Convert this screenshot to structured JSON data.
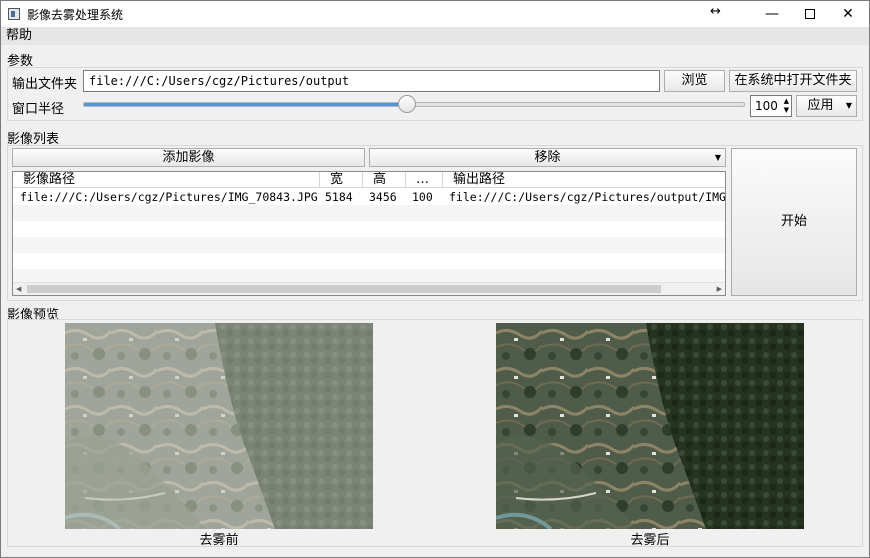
{
  "window": {
    "title": "影像去雾处理系统",
    "resize_glyph": "↔",
    "min_glyph": "—",
    "close_glyph": "✕"
  },
  "menu": {
    "help": "帮助"
  },
  "params": {
    "section_title": "参数",
    "output_folder_label": "输出文件夹",
    "output_folder_value": "file:///C:/Users/cgz/Pictures/output",
    "browse_label": "浏览",
    "open_folder_label": "在系统中打开文件夹",
    "window_radius_label": "窗口半径",
    "window_radius_value": "100",
    "slider_fraction": 0.49,
    "apply_label": "应用"
  },
  "image_list": {
    "section_title": "影像列表",
    "add_label": "添加影像",
    "remove_label": "移除",
    "columns": [
      "影像路径",
      "宽",
      "高",
      "…",
      "输出路径"
    ],
    "rows": [
      {
        "path": "file:///C:/Users/cgz/Pictures/IMG_70843.JPG",
        "width": "5184",
        "height": "3456",
        "extra": "100",
        "output": "file:///C:/Users/cgz/Pictures/output/IMG_"
      }
    ],
    "start_label": "开始"
  },
  "preview": {
    "section_title": "影像预览",
    "before_caption": "去雾前",
    "after_caption": "去雾后"
  },
  "colors": {
    "accent": "#4f95e0",
    "hazy_tint": "#a8ada3",
    "clear_tint": "#3b4a3a"
  }
}
